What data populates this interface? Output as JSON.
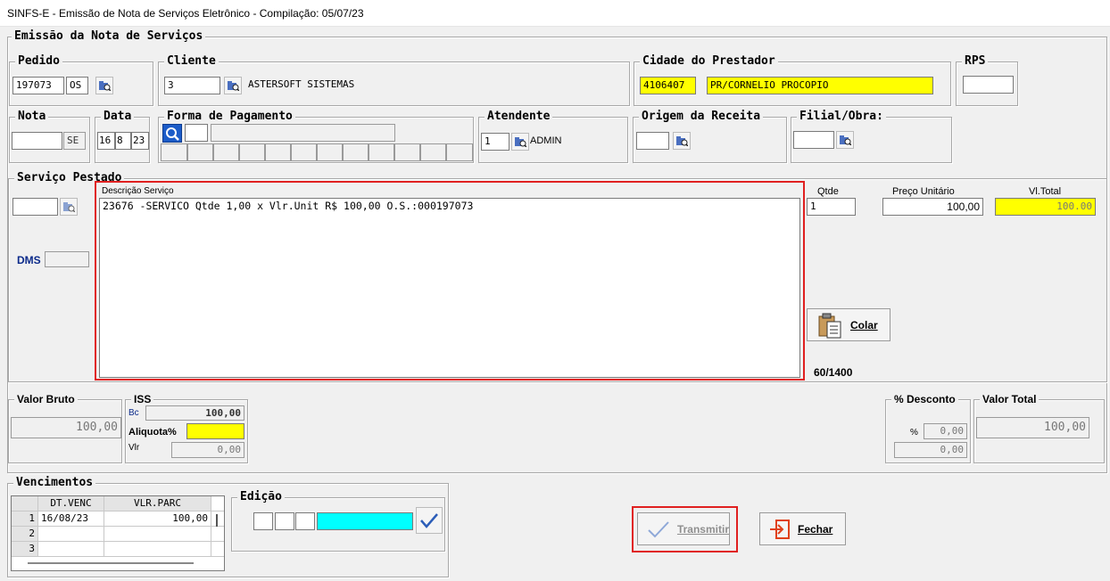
{
  "window": {
    "title": "SINFS-E - Emissão de Nota de Serviços Eletrônico - Compilação: 05/07/23"
  },
  "main_group": {
    "label": "Emissão da Nota de Serviços"
  },
  "pedido": {
    "label": "Pedido",
    "number": "197073",
    "type": "OS"
  },
  "cliente": {
    "label": "Cliente",
    "code": "3",
    "name": "ASTERSOFT SISTEMAS"
  },
  "cidade": {
    "label": "Cidade do Prestador",
    "code": "4106407",
    "name": "PR/CORNELIO PROCOPIO"
  },
  "rps": {
    "label": "RPS",
    "value": ""
  },
  "nota": {
    "label": "Nota",
    "number": "",
    "serie": "SE"
  },
  "data": {
    "label": "Data",
    "day": "16",
    "month": "8",
    "year": "23"
  },
  "forma_pagamento": {
    "label": "Forma de  Pagamento",
    "code": "",
    "desc": ""
  },
  "atendente": {
    "label": "Atendente",
    "code": "1",
    "name": "ADMIN"
  },
  "origem_receita": {
    "label": "Origem da Receita",
    "code": ""
  },
  "filial_obra": {
    "label": "Filial/Obra:",
    "code": ""
  },
  "servico": {
    "label": "Serviço Pestado",
    "code": "",
    "dms_label": "DMS",
    "dms_value": "",
    "desc_label": "Descrição Serviço",
    "description": "23676 -SERVICO Qtde 1,00 x Vlr.Unit R$ 100,00 O.S.:000197073",
    "qtde_label": "Qtde",
    "qtde": "1",
    "preco_label": "Preço Unitário",
    "preco": "100,00",
    "total_label": "Vl.Total",
    "total": "100.00",
    "char_count": "60/1400",
    "colar_label": "Colar"
  },
  "valor_bruto": {
    "label": "Valor Bruto",
    "value": "100,00"
  },
  "iss": {
    "label": "ISS",
    "bc_label": "Bc",
    "bc": "100,00",
    "aliquota_label": "Aliquota%",
    "aliquota": "",
    "vlr_label": "Vlr",
    "vlr": "0,00"
  },
  "desconto": {
    "label": "% Desconto",
    "pct_label": "%",
    "pct": "0,00",
    "value": "0,00"
  },
  "valor_total": {
    "label": "Valor Total",
    "value": "100,00"
  },
  "vencimentos": {
    "label": "Vencimentos",
    "col_date": "DT.VENC",
    "col_value": "VLR.PARC",
    "rows": [
      {
        "n": "1",
        "date": "16/08/23",
        "value": "100,00"
      },
      {
        "n": "2",
        "date": "",
        "value": ""
      },
      {
        "n": "3",
        "date": "",
        "value": ""
      }
    ]
  },
  "edicao": {
    "label": "Edição"
  },
  "buttons": {
    "transmitir": "Transmitir",
    "fechar": "Fechar"
  },
  "colors": {
    "accent_red": "#e02020",
    "highlight_yellow": "#ffff00",
    "highlight_cyan": "#00ffff",
    "label_blue": "#0b2a8a"
  }
}
